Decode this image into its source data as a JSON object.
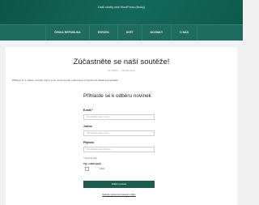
{
  "header": {
    "site_title": "Další skvělý web WordPress (titulky)"
  },
  "nav": {
    "items": [
      "ČESKÁ REPUBLIKA",
      "EVROPA",
      "SVĚT",
      "NOVINKY",
      "O NÁS"
    ]
  },
  "post": {
    "title": "Zúčastněte se naší soutěže!",
    "meta": "16.7.2020 — zobrazit ve/on",
    "intro": "Přihlaste se k odběru novinek. Pak a tvrou novou dovalo vyplnovesh a zobrazit dle šablai dovolopafitul."
  },
  "form": {
    "title": "Přihlaste se k odběru novinek",
    "email_label": "E-mail",
    "email_required": "*",
    "email_placeholder": "Zde zadejte vaše e-mail",
    "firstname_label": "Jméno",
    "firstname_placeholder": "Zde zadejte vaše jméno",
    "lastname_label": "Příjmení",
    "lastname_placeholder": "Zde zadejte vaše příjmení",
    "required_note": "* Povinná pole",
    "list_title": "Typ odběratelů",
    "list_option": "1234",
    "submit_label": "Odběr novinek",
    "manage_link": "Zadejte spravovat stávající odběr"
  },
  "colors": {
    "header": "#0f5a4c",
    "nav": "#1f6b5d",
    "button": "#1b5e4e"
  }
}
